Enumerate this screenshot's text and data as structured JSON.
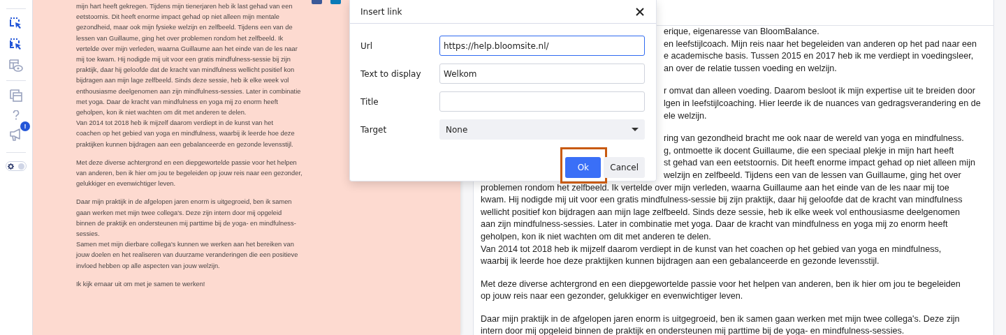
{
  "sidebar": {
    "items": [
      {
        "kind": "select-tool",
        "active": true
      },
      {
        "kind": "multi-select-tool",
        "active": true
      },
      {
        "kind": "preview-layout",
        "active": false
      },
      {
        "kind": "divider"
      },
      {
        "kind": "windows",
        "active": false
      },
      {
        "kind": "help",
        "active": false
      },
      {
        "kind": "announcements",
        "active": false,
        "badge": "!"
      },
      {
        "kind": "divider"
      },
      {
        "kind": "theme-toggle",
        "on": false
      }
    ]
  },
  "preview": {
    "social": [
      {
        "kind": "facebook"
      },
      {
        "kind": "linkedin"
      }
    ],
    "paragraphs": [
      {
        "lines": [
          "mijn hart heeft gekregen. Tijdens mijn tienerjaren heb ik last gehad van een",
          "eetstoornis. Dit heeft enorme impact gehad op niet alleen mijn mentale",
          "gezondheid, maar ook mijn fysieke welzijn en zelfbeeld. Tijdens een van de",
          "lessen van Guillaume, ging het over problemen rondom het zelfbeeld. Ik",
          "vertelde over mijn verleden, waarna Guillaume aan het einde van de les naar",
          "mij toe kwam. Hij nodigde mij uit voor een gratis mindfulness-sessie bij zijn",
          "praktijk, daar hij geloofde dat de kracht van mindfulness wellicht positief kon",
          "bijdragen aan mijn lage zelfbeeld. Sinds deze sessie, heb ik elke week vol",
          "enthousiasme deelgenomen aan zijn mindfulness-sessies. Later in combinatie",
          "met yoga. Daar de kracht van mindfulness en yoga mij zo enorm heeft",
          "geholpen, kon ik niet wachten om dit met anderen te delen.",
          "Van 2014 tot 2018 heb ik mijzelf daarom verdiept in de kunst van het",
          "coachen op het gebied van yoga en mindfulness, waarbij ik leerde hoe deze",
          "praktijken kunnen bijdragen aan een gebalanceerde en gezonde levensstijl."
        ]
      },
      {
        "lines": [
          "Met deze diverse achtergrond en een diepgewortelde passie voor het helpen",
          "van anderen, ben ik hier om jou te begeleiden op jouw reis naar een gezonder,",
          "gelukkiger en evenwichtiger leven."
        ]
      },
      {
        "lines": [
          "Daar mijn praktijk in de afgelopen jaren enorm is uitgegroeid, ben ik samen",
          "gaan werken met mijn twee collega's. Deze zijn intern door mij opgeleid",
          "binnen de praktijk en ondersteunen mij parttime bij de yoga- en mindfulness-",
          "sessies.",
          "Samen met mijn dierbare collega's kunnen we werken aan het bereiken van",
          "jouw doelen en het realiseren van duurzame veranderingen die een positieve",
          "invloed hebben op alle aspecten van jouw welzijn."
        ]
      },
      {
        "lines": [
          "Ik kijk ernaar uit om met je samen te werken!"
        ]
      }
    ]
  },
  "editor": {
    "paragraphs": [
      {
        "fragments": [
          "erique, eigenaresse van BloomBalance.",
          "en leefstijlcoach. Mijn reis naar het begeleiden van anderen op het pad naar een",
          "e academische basis. Tussen 2015 en 2017 heb ik me verdiept in voedingsleer,",
          "an over de relatie tussen voeding en welzijn."
        ]
      },
      {
        "fragments": [
          "r omvat dan alleen voeding. Daarom besloot ik mijn expertise uit te breiden door",
          "lgen in leefstijlcoaching. Hier leerde ik de nuances van gedragsverandering en de",
          "ele welzijn."
        ]
      },
      {
        "fragments": [
          "ring van gezondheid bracht me ook naar de wereld van yoga en mindfulness.",
          "g, ontmoette ik docent Guillaume, die een speciaal plekje in mijn hart heeft",
          "st gehad van een eetstoornis. Dit heeft enorme impact gehad op niet alleen mijn",
          "welzijn en zelfbeeld. Tijdens een van de lessen van Guillaume, ging het over"
        ],
        "lines": [
          "problemen rondom het zelfbeeld. Ik vertelde over mijn verleden, waarna Guillaume aan het einde van de les naar mij toe",
          "kwam. Hij nodigde mij uit voor een gratis mindfulness-sessie bij zijn praktijk, daar hij geloofde dat de kracht van mindfulness",
          "wellicht positief kon bijdragen aan mijn lage zelfbeeld. Sinds deze sessie, heb ik elke week vol enthousiasme deelgenomen",
          "aan zijn mindfulness-sessies. Later in combinatie met yoga. Daar de kracht van mindfulness en yoga mij zo enorm heeft",
          "geholpen, kon ik niet wachten om dit met anderen te delen.",
          "Van 2014 tot 2018 heb ik mijzelf daarom verdiept in de kunst van het coachen op het gebied van yoga en mindfulness,",
          "waarbij ik leerde hoe deze praktijken kunnen bijdragen aan een gebalanceerde en gezonde levensstijl."
        ]
      },
      {
        "lines": [
          "Met deze diverse achtergrond en een diepgewortelde passie voor het helpen van anderen, ben ik hier om jou te begeleiden",
          "op jouw reis naar een gezonder, gelukkiger en evenwichtiger leven."
        ]
      },
      {
        "lines": [
          "Daar mijn praktijk in de afgelopen jaren enorm is uitgegroeid, ben ik samen gaan werken met mijn twee collega's. Deze zijn",
          "intern door mij opgeleid binnen de praktijk en ondersteunen mij parttime bij de yoga- en mindfulness-sessies."
        ]
      }
    ]
  },
  "dialog": {
    "title": "Insert link",
    "fields": [
      {
        "label": "Url",
        "kind": "text",
        "value": "https://help.bloomsite.nl/",
        "focused": true
      },
      {
        "label": "Text to display",
        "kind": "text",
        "value": "Welkom",
        "focused": false
      },
      {
        "label": "Title",
        "kind": "text",
        "focused": false
      },
      {
        "label": "Target",
        "kind": "select",
        "value": "None",
        "focused": false
      }
    ],
    "buttons": [
      {
        "label": "Ok",
        "kind": "primary",
        "highlighted": true
      },
      {
        "label": "Cancel",
        "kind": "secondary",
        "highlighted": false
      }
    ]
  }
}
